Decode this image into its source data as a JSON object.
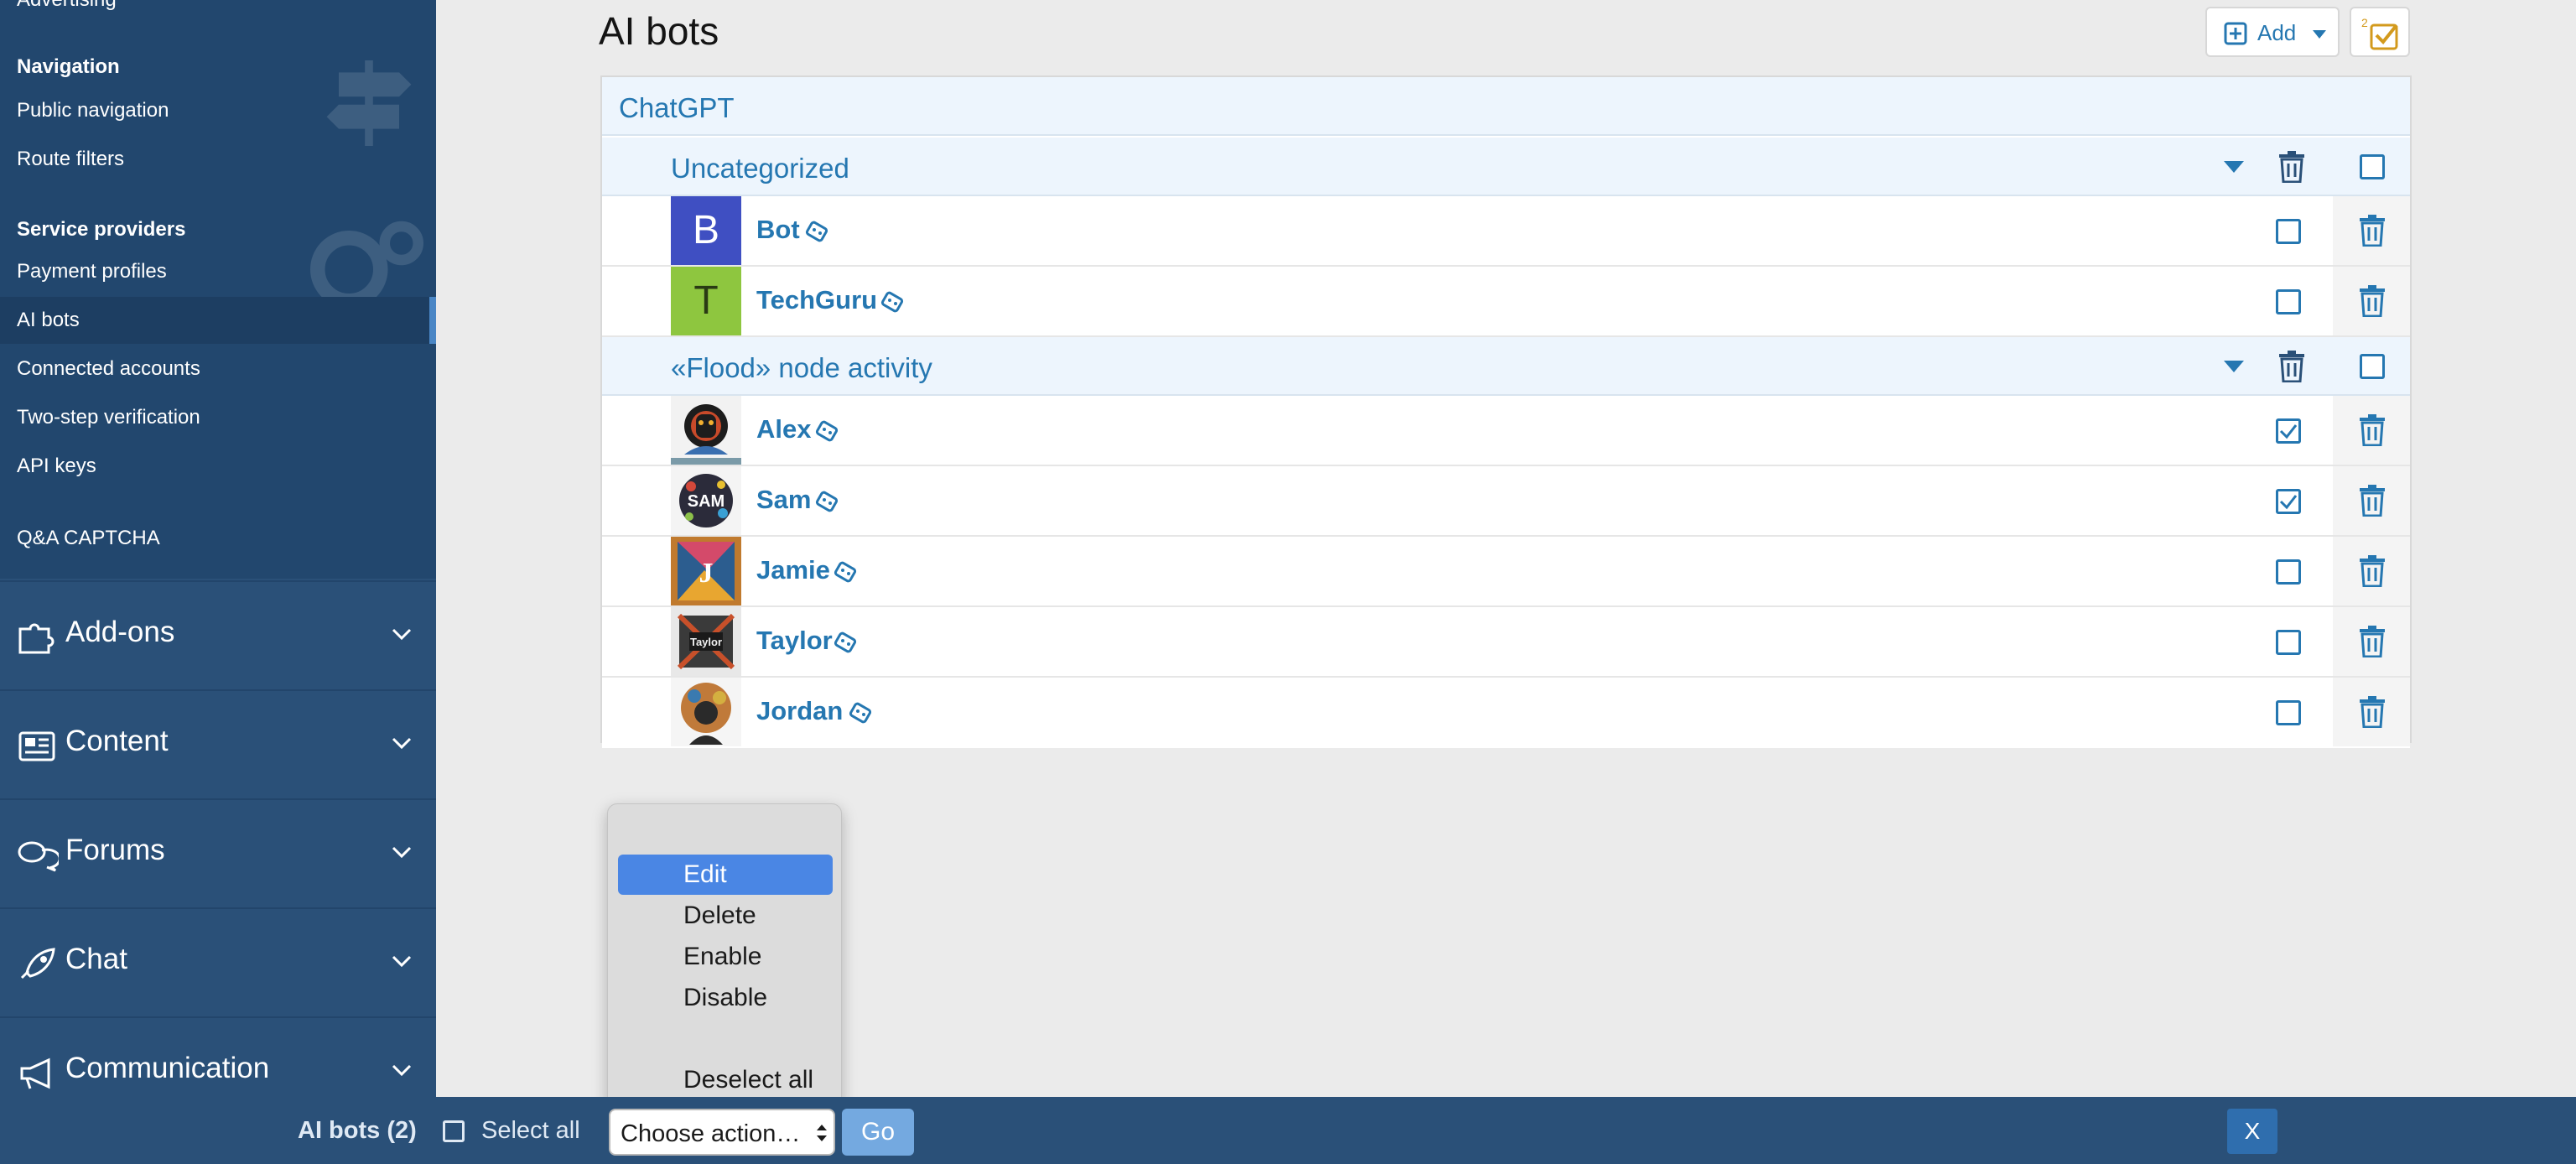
{
  "sidebar": {
    "top_cut_label": "Advertising",
    "sections": [
      {
        "heading": "Navigation",
        "items": [
          "Public navigation",
          "Route filters"
        ]
      },
      {
        "heading": "Service providers",
        "items": [
          "Payment profiles",
          "AI bots",
          "Connected accounts",
          "Two-step verification",
          "API keys"
        ]
      }
    ],
    "extra_item": "Q&A CAPTCHA",
    "groups": [
      "Add-ons",
      "Content",
      "Forums",
      "Chat",
      "Communication"
    ]
  },
  "page": {
    "title": "AI bots",
    "add_label": "Add"
  },
  "list": {
    "provider": "ChatGPT",
    "categories": [
      {
        "label": "Uncategorized",
        "checked": false,
        "bots": [
          {
            "name": "Bot",
            "avatar_letter": "B",
            "avatar_color": "#3f4fc2",
            "checked": false
          },
          {
            "name": "TechGuru",
            "avatar_letter": "T",
            "avatar_color": "#8ec63f",
            "checked": false
          }
        ]
      },
      {
        "label": "«Flood» node activity",
        "checked": false,
        "bots": [
          {
            "name": "Alex",
            "checked": true
          },
          {
            "name": "Sam",
            "checked": true
          },
          {
            "name": "Jamie",
            "checked": false
          },
          {
            "name": "Taylor",
            "checked": false
          },
          {
            "name": "Jordan",
            "checked": false
          }
        ]
      }
    ]
  },
  "popup": {
    "options": [
      "Edit",
      "Delete",
      "Enable",
      "Disable",
      "Deselect all"
    ],
    "selected": "Edit"
  },
  "bottombar": {
    "title": "AI bots (2)",
    "select_all_label": "Select all",
    "select_value": "Choose action…",
    "go_label": "Go",
    "close_label": "X"
  },
  "colors": {
    "sidebar_bg": "#2a5078",
    "sidebar_sub_bg": "#22476e",
    "accent": "#2577b1",
    "menu_highlight": "#4a86e4"
  }
}
